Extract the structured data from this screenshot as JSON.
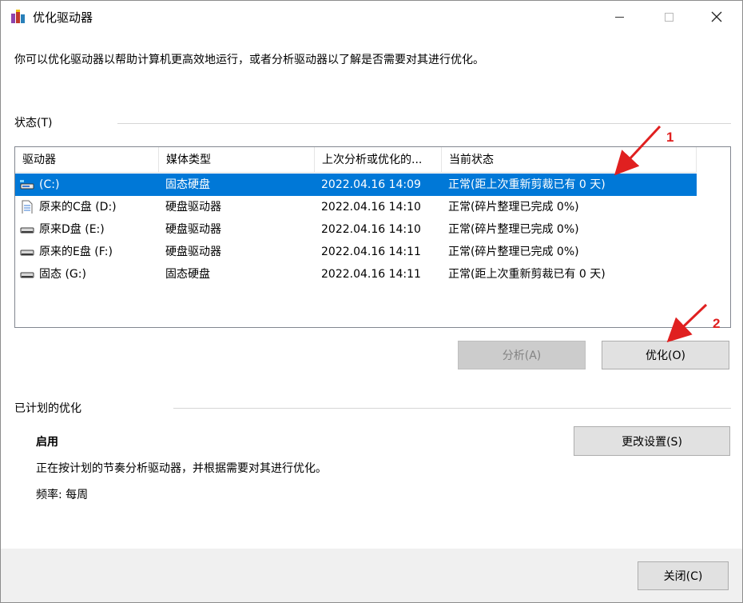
{
  "window": {
    "title": "优化驱动器",
    "minimize_icon": "minimize-icon",
    "maximize_icon": "maximize-icon",
    "close_icon": "close-icon"
  },
  "description": "你可以优化驱动器以帮助计算机更高效地运行，或者分析驱动器以了解是否需要对其进行优化。",
  "status_section": {
    "label": "状态(T)",
    "columns": [
      "驱动器",
      "媒体类型",
      "上次分析或优化的...",
      "当前状态"
    ],
    "drives": [
      {
        "name": "(C:)",
        "media": "固态硬盘",
        "last": "2022.04.16 14:09",
        "status": "正常(距上次重新剪裁已有 0 天)",
        "icon": "ssd-drive-icon",
        "selected": true
      },
      {
        "name": "原来的C盘 (D:)",
        "media": "硬盘驱动器",
        "last": "2022.04.16 14:10",
        "status": "正常(碎片整理已完成 0%)",
        "icon": "document-drive-icon",
        "selected": false
      },
      {
        "name": "原来D盘 (E:)",
        "media": "硬盘驱动器",
        "last": "2022.04.16 14:10",
        "status": "正常(碎片整理已完成 0%)",
        "icon": "hdd-drive-icon",
        "selected": false
      },
      {
        "name": "原来的E盘 (F:)",
        "media": "硬盘驱动器",
        "last": "2022.04.16 14:11",
        "status": "正常(碎片整理已完成 0%)",
        "icon": "hdd-drive-icon",
        "selected": false
      },
      {
        "name": "固态 (G:)",
        "media": "固态硬盘",
        "last": "2022.04.16 14:11",
        "status": "正常(距上次重新剪裁已有 0 天)",
        "icon": "hdd-drive-icon",
        "selected": false
      }
    ],
    "analyze_label": "分析(A)",
    "optimize_label": "优化(O)"
  },
  "scheduled_section": {
    "label": "已计划的优化",
    "state": "启用",
    "description": "正在按计划的节奏分析驱动器，并根据需要对其进行优化。",
    "frequency": "频率: 每周",
    "change_settings_label": "更改设置(S)"
  },
  "footer": {
    "close_label": "关闭(C)"
  },
  "annotations": [
    {
      "label": "1"
    },
    {
      "label": "2"
    }
  ],
  "colors": {
    "selection": "#0078d7",
    "annotation": "#e02020",
    "button_face": "#e1e1e1",
    "footer_bg": "#f0f0f0"
  }
}
